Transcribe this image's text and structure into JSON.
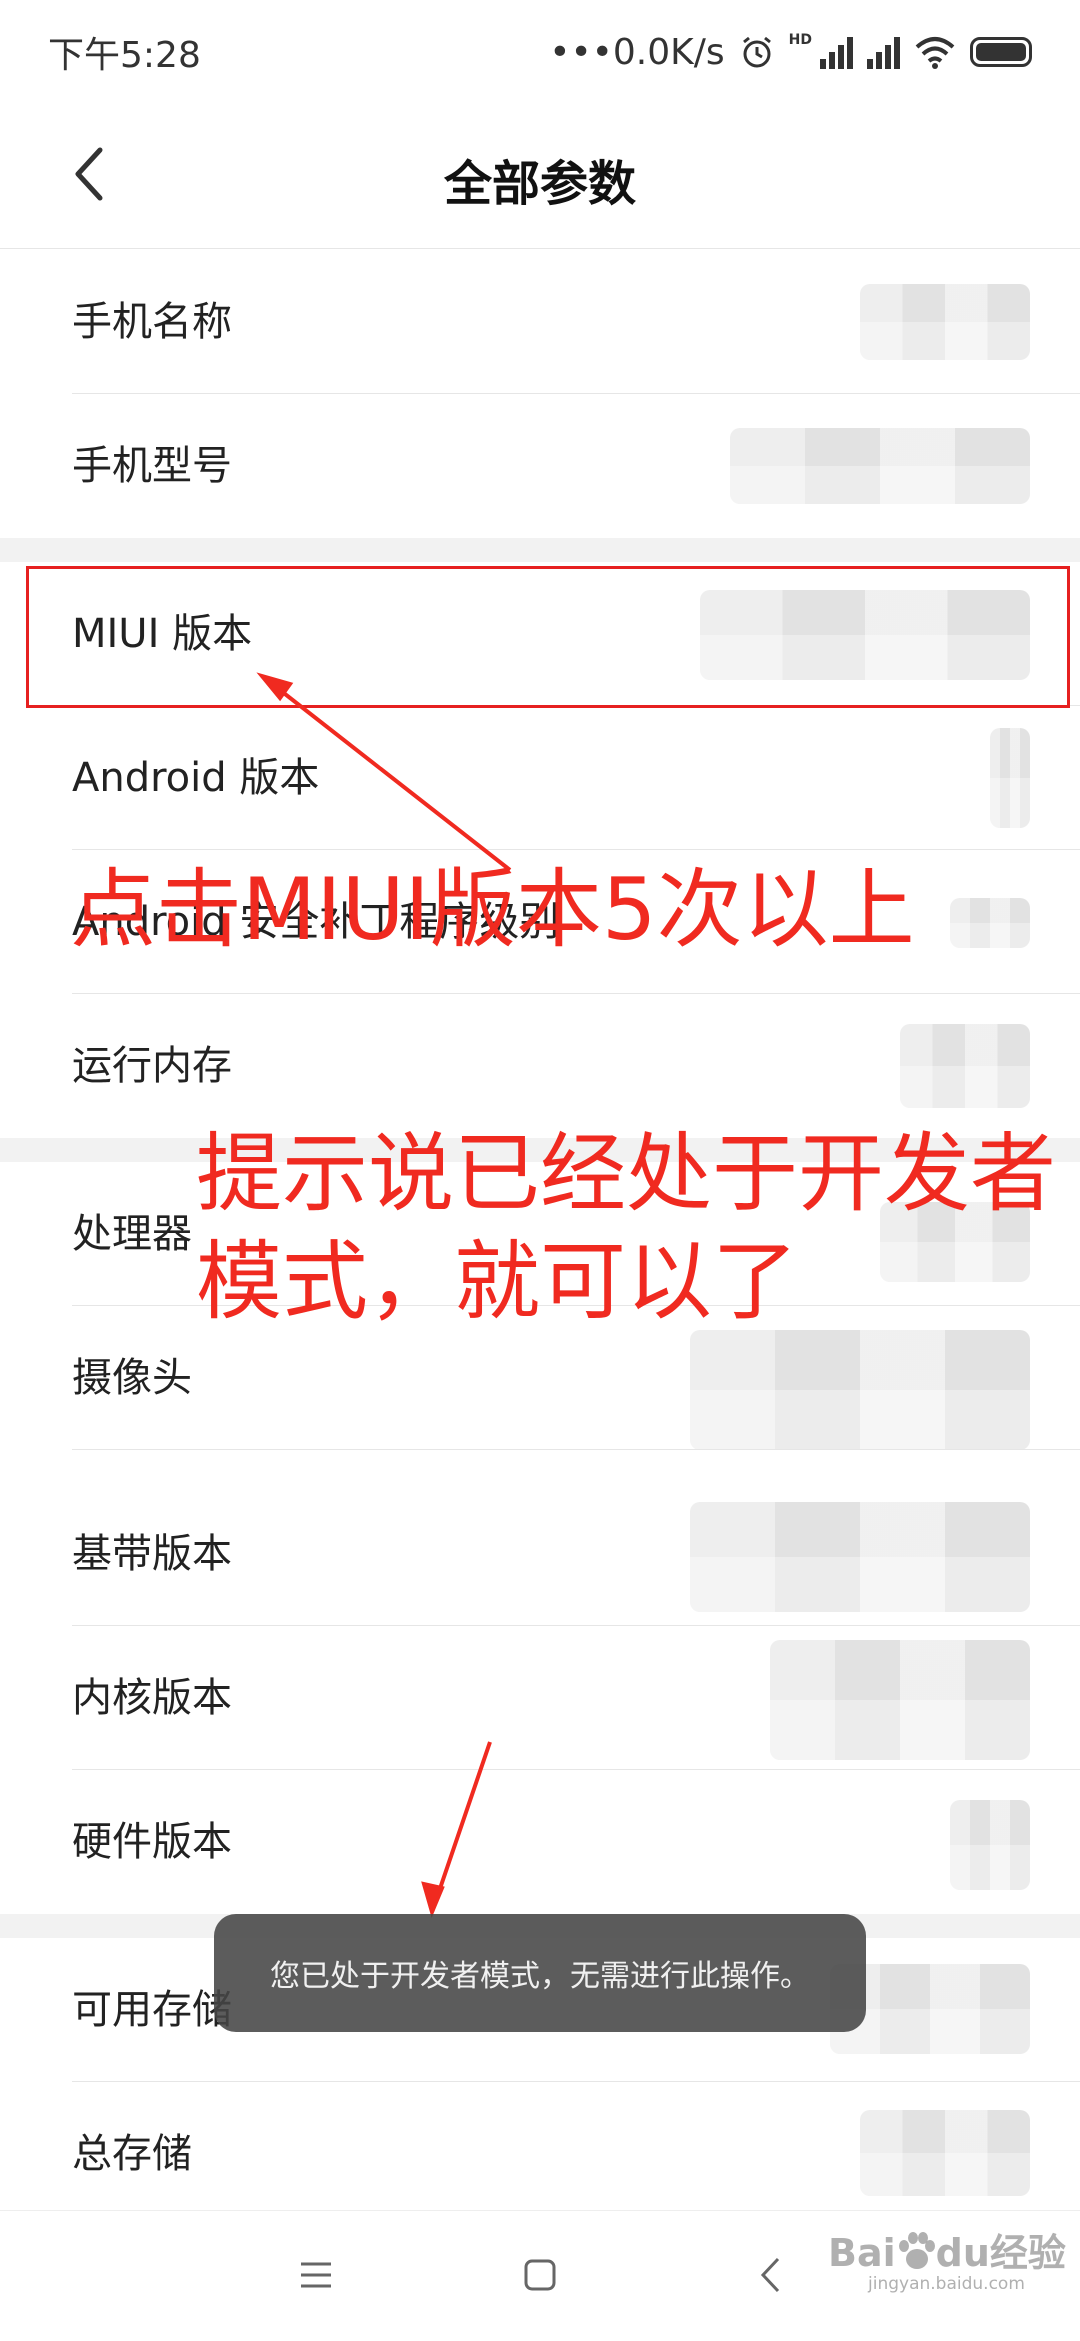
{
  "status_bar": {
    "time": "下午5:28",
    "network_speed": "•••0.0K/s",
    "hd_label": "HD",
    "icons": [
      "alarm-icon",
      "signal-icon",
      "wifi-icon",
      "battery-icon"
    ]
  },
  "title_bar": {
    "title": "全部参数",
    "back_icon": "chevron-left-icon"
  },
  "rows": [
    {
      "label": "手机名称"
    },
    {
      "label": "手机型号"
    },
    {
      "label": "MIUI 版本"
    },
    {
      "label": "Android 版本"
    },
    {
      "label": "Android 安全补丁程序级别"
    },
    {
      "label": "运行内存"
    },
    {
      "label": "处理器"
    },
    {
      "label": "摄像头"
    },
    {
      "label": "基带版本"
    },
    {
      "label": "内核版本"
    },
    {
      "label": "硬件版本"
    },
    {
      "label": "可用存储"
    },
    {
      "label": "总存储"
    }
  ],
  "annotations": {
    "instruction_1": "点击MIUI版本5次以上",
    "instruction_2": "提示说已经处于开发者模式，就可以了",
    "highlight_color": "#e62020",
    "text_color": "#f02a20"
  },
  "toast": {
    "message": "您已处于开发者模式，无需进行此操作。"
  },
  "nav_bar": {
    "icons": [
      "menu-icon",
      "home-icon",
      "back-icon"
    ]
  },
  "watermark": {
    "brand": "Bai",
    "brand_suffix": "du",
    "brand_cn": "经验",
    "url": "jingyan.baidu.com"
  }
}
